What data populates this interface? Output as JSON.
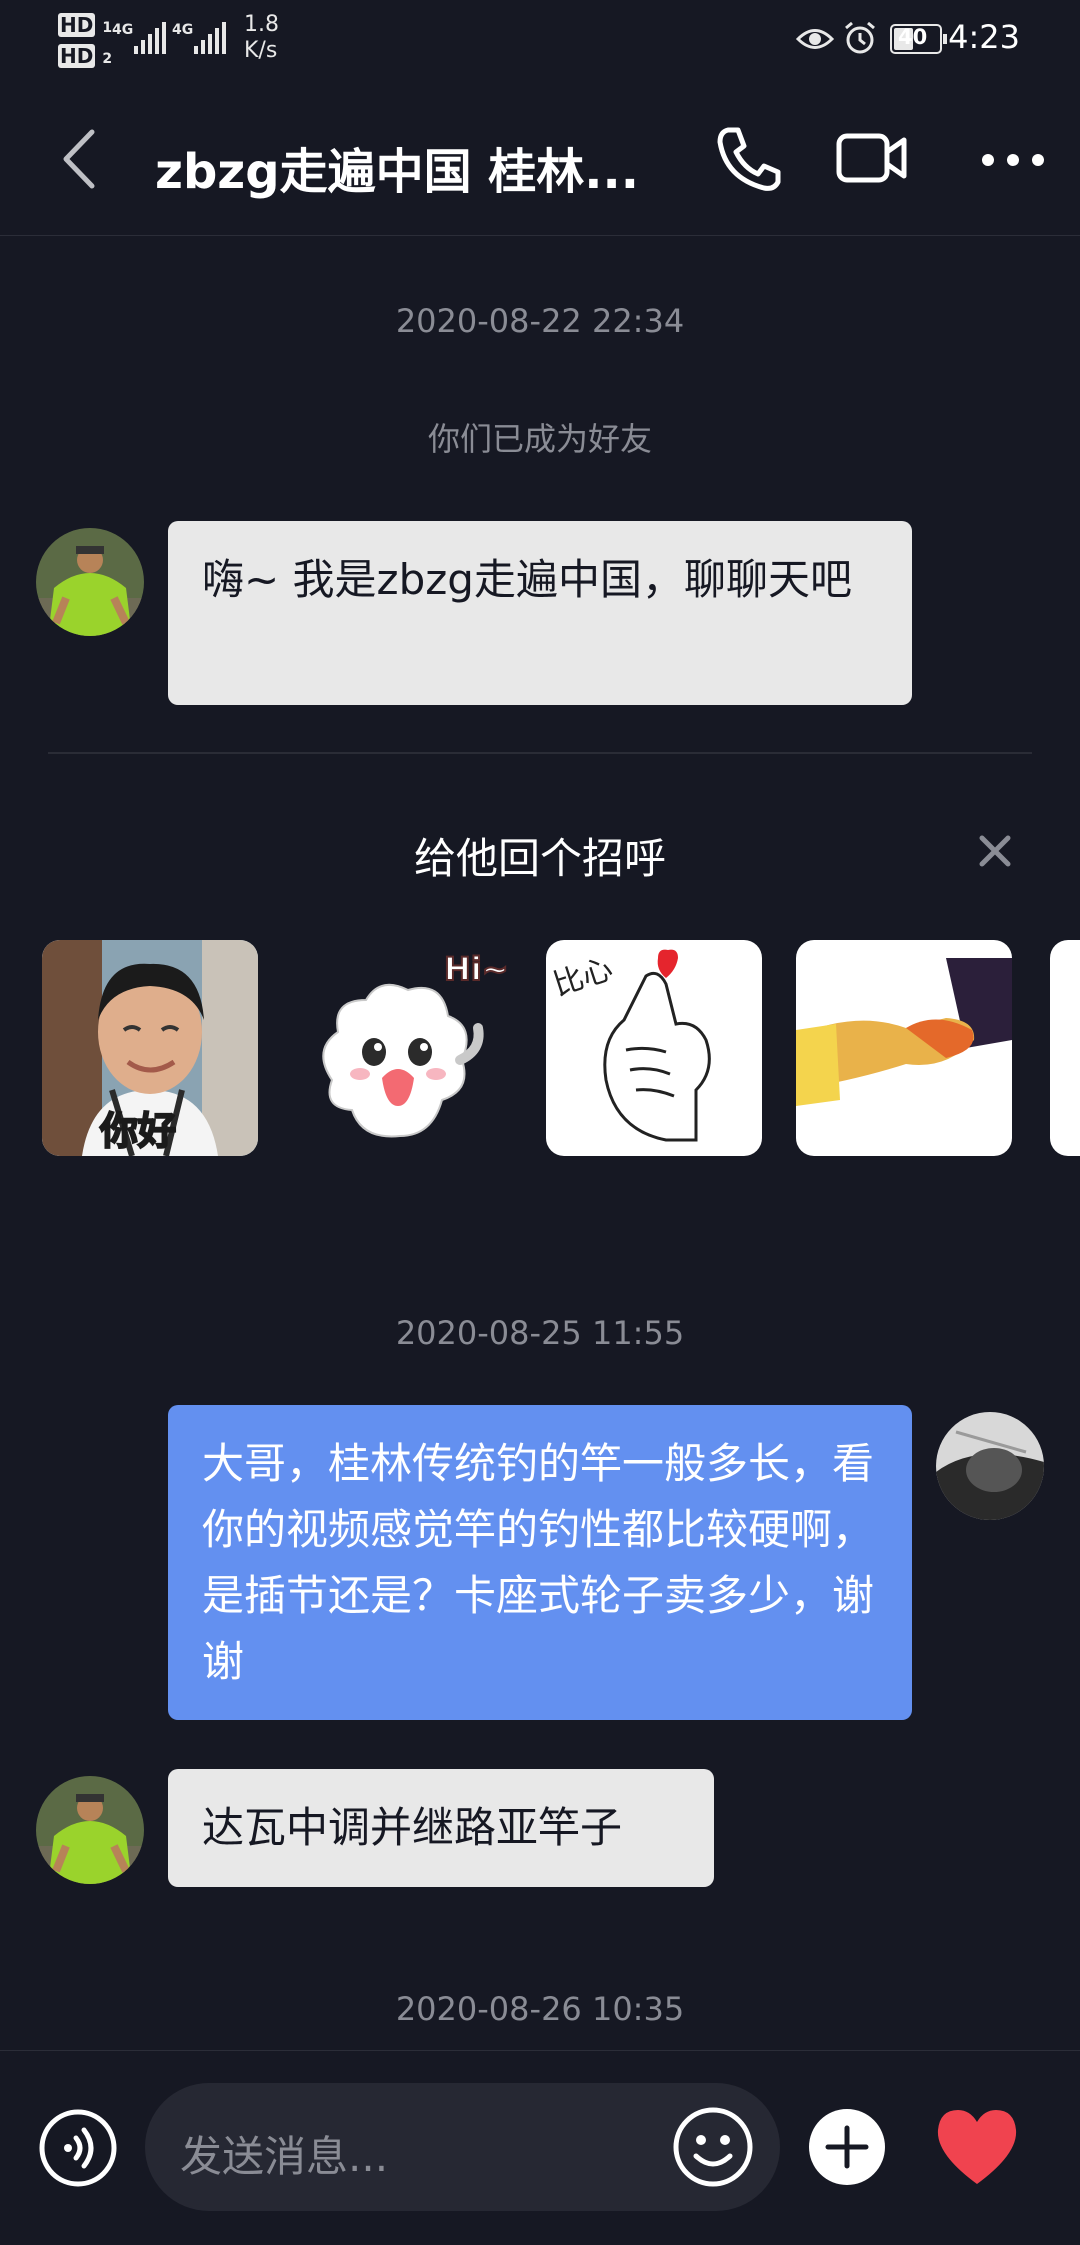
{
  "status_bar": {
    "sim1": "HD",
    "sim1_num": "1",
    "sim2": "HD",
    "sim2_num": "2",
    "net1": "4G",
    "net2": "4G",
    "speed_value": "1.8",
    "speed_unit": "K/s",
    "battery": "40",
    "time": "4:23"
  },
  "header": {
    "title": "zbzg走遍中国  桂林...",
    "back_icon": "chevron-left-icon",
    "call_icon": "phone-icon",
    "video_icon": "video-camera-icon",
    "more_icon": "more-dots-icon"
  },
  "messages": {
    "ts1": "2020-08-22 22:34",
    "system": "你们已成为好友",
    "m1": "嗨~ 我是zbzg走遍中国，聊聊天吧",
    "greet_title": "给他回个招呼",
    "sticker1_text": "你好",
    "sticker2_text": "Hi~",
    "sticker3_text": "比心",
    "ts2": "2020-08-25 11:55",
    "m2": "大哥，桂林传统钓的竿一般多长，看你的视频感觉竿的钓性都比较硬啊，是插节还是？卡座式轮子卖多少，谢谢",
    "m3": "达瓦中调并继路亚竿子",
    "ts3": "2020-08-26 10:35"
  },
  "input": {
    "placeholder": "发送消息..."
  },
  "colors": {
    "background": "#161823",
    "incoming_bubble": "#e8e8e8",
    "outgoing_bubble": "#6390f0",
    "heart": "#f0434f"
  }
}
